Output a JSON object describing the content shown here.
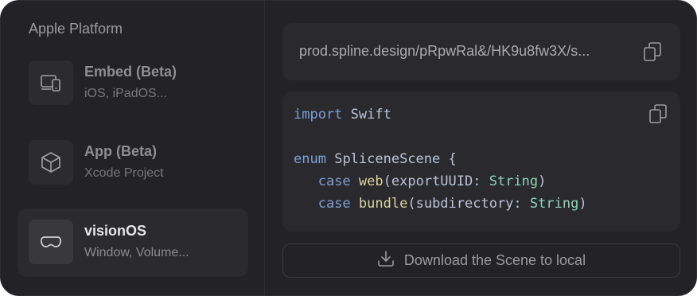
{
  "sidebar": {
    "title": "Apple Platform",
    "items": [
      {
        "title": "Embed (Beta)",
        "subtitle": "iOS, iPadOS...",
        "icon": "devices-icon"
      },
      {
        "title": "App (Beta)",
        "subtitle": "Xcode Project",
        "icon": "cube-icon"
      },
      {
        "title": "visionOS",
        "subtitle": "Window, Volume...",
        "icon": "vision-pro-icon",
        "selected": true
      }
    ]
  },
  "url": {
    "text": "prod.spline.design/pRpwRal&/HK9u8fw3X/s...",
    "copy_icon": "copy-icon"
  },
  "code": {
    "lines": [
      [
        "import",
        "Swift"
      ],
      [],
      [
        "enum",
        "SpliceneScene",
        "{"
      ],
      [
        "case",
        "web",
        "(",
        "exportUUID",
        ":",
        "String",
        ")"
      ],
      [
        "case",
        "bundle",
        "(",
        "subdirectory",
        ":",
        "String",
        ")"
      ]
    ],
    "t_import": "import",
    "t_swift": "Swift",
    "t_enum": "enum",
    "t_scene": "SpliceneScene",
    "t_brace": "{",
    "t_case": "case",
    "t_web": "web",
    "t_export": "exportUUID",
    "t_string": "String",
    "t_bundle": "bundle",
    "t_subdir": "subdirectory",
    "copy_icon": "copy-icon"
  },
  "download": {
    "label": "Download the Scene to local",
    "icon": "download-icon"
  },
  "colors": {
    "background": "#232326",
    "card": "#2a2a2e",
    "keyword": "#7f9fd4",
    "function": "#d9d3a0",
    "type": "#8fd4b4"
  }
}
